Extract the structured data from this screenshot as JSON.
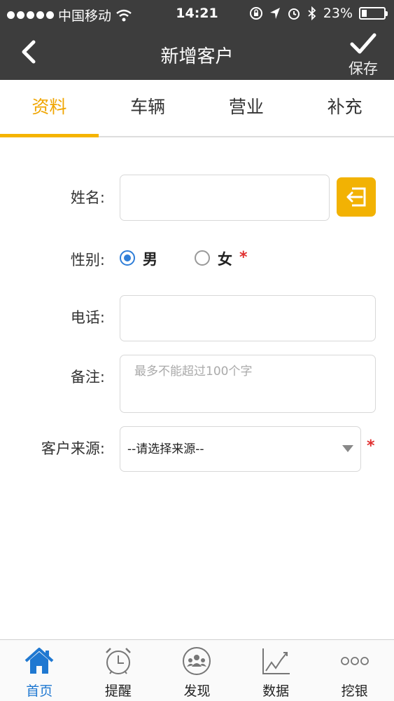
{
  "status_bar": {
    "carrier": "中国移动",
    "time": "14:21",
    "battery": "23%",
    "battery_level": 0.23
  },
  "nav": {
    "title": "新增客户",
    "save_label": "保存"
  },
  "tabs": [
    {
      "label": "资料",
      "active": true
    },
    {
      "label": "车辆",
      "active": false
    },
    {
      "label": "营业",
      "active": false
    },
    {
      "label": "补充",
      "active": false
    }
  ],
  "form": {
    "name": {
      "label": "姓名:",
      "value": ""
    },
    "gender": {
      "label": "性别:",
      "options": [
        "男",
        "女"
      ],
      "selected": "男",
      "required_mark": "*"
    },
    "phone": {
      "label": "电话:",
      "value": ""
    },
    "note": {
      "label": "备注:",
      "placeholder": "最多不能超过100个字",
      "value": ""
    },
    "source": {
      "label": "客户来源:",
      "selected": "--请选择来源--",
      "required_mark": "*"
    }
  },
  "colors": {
    "accent": "#f0a500",
    "header_bg": "#3d3d3d",
    "active_tab_blue": "#1f78d1",
    "required": "#e03030"
  },
  "bottom_tabs": [
    {
      "label": "首页",
      "icon": "home-icon",
      "active": true
    },
    {
      "label": "提醒",
      "icon": "alarm-clock-icon",
      "active": false
    },
    {
      "label": "发现",
      "icon": "group-icon",
      "active": false
    },
    {
      "label": "数据",
      "icon": "trend-chart-icon",
      "active": false
    },
    {
      "label": "挖银",
      "icon": "more-dots-icon",
      "active": false
    }
  ]
}
